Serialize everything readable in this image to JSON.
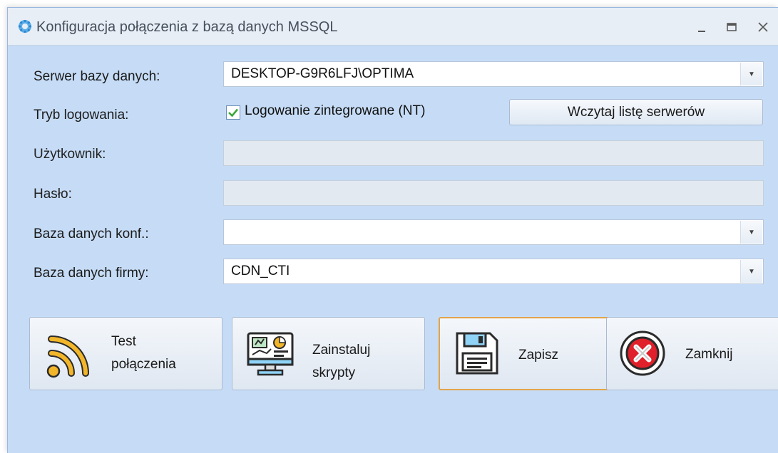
{
  "window": {
    "title": "Konfiguracja połączenia z bazą danych MSSQL",
    "controls": {
      "minimize": "_",
      "maximize": "□",
      "close": "X"
    }
  },
  "form": {
    "server": {
      "label": "Serwer bazy danych:",
      "value": "DESKTOP-G9R6LFJ\\OPTIMA"
    },
    "login_mode": {
      "label": "Tryb logowania:",
      "checkbox_label": "Logowanie zintegrowane (NT)",
      "checked": true,
      "load_servers_button": "Wczytaj listę serwerów"
    },
    "user": {
      "label": "Użytkownik:",
      "value": ""
    },
    "password": {
      "label": "Hasło:",
      "value": ""
    },
    "config_db": {
      "label": "Baza danych konf.:",
      "value": ""
    },
    "company_db": {
      "label": "Baza danych firmy:",
      "value": "CDN_CTI"
    }
  },
  "buttons": {
    "test": {
      "line1": "Test",
      "line2": "połączenia",
      "icon": "wifi-signal-icon"
    },
    "install": {
      "line1": "Zainstaluj",
      "line2": "skrypty",
      "icon": "monitor-dashboard-icon"
    },
    "save": {
      "label": "Zapisz",
      "icon": "floppy-disk-icon"
    },
    "close": {
      "label": "Zamknij",
      "icon": "close-circle-icon"
    }
  },
  "colors": {
    "window_bg": "#c6dcf6",
    "titlebar_bg": "#e8eef6",
    "focus_border": "#e3a34a",
    "check_green": "#3aa63a",
    "close_red": "#e0202a"
  }
}
